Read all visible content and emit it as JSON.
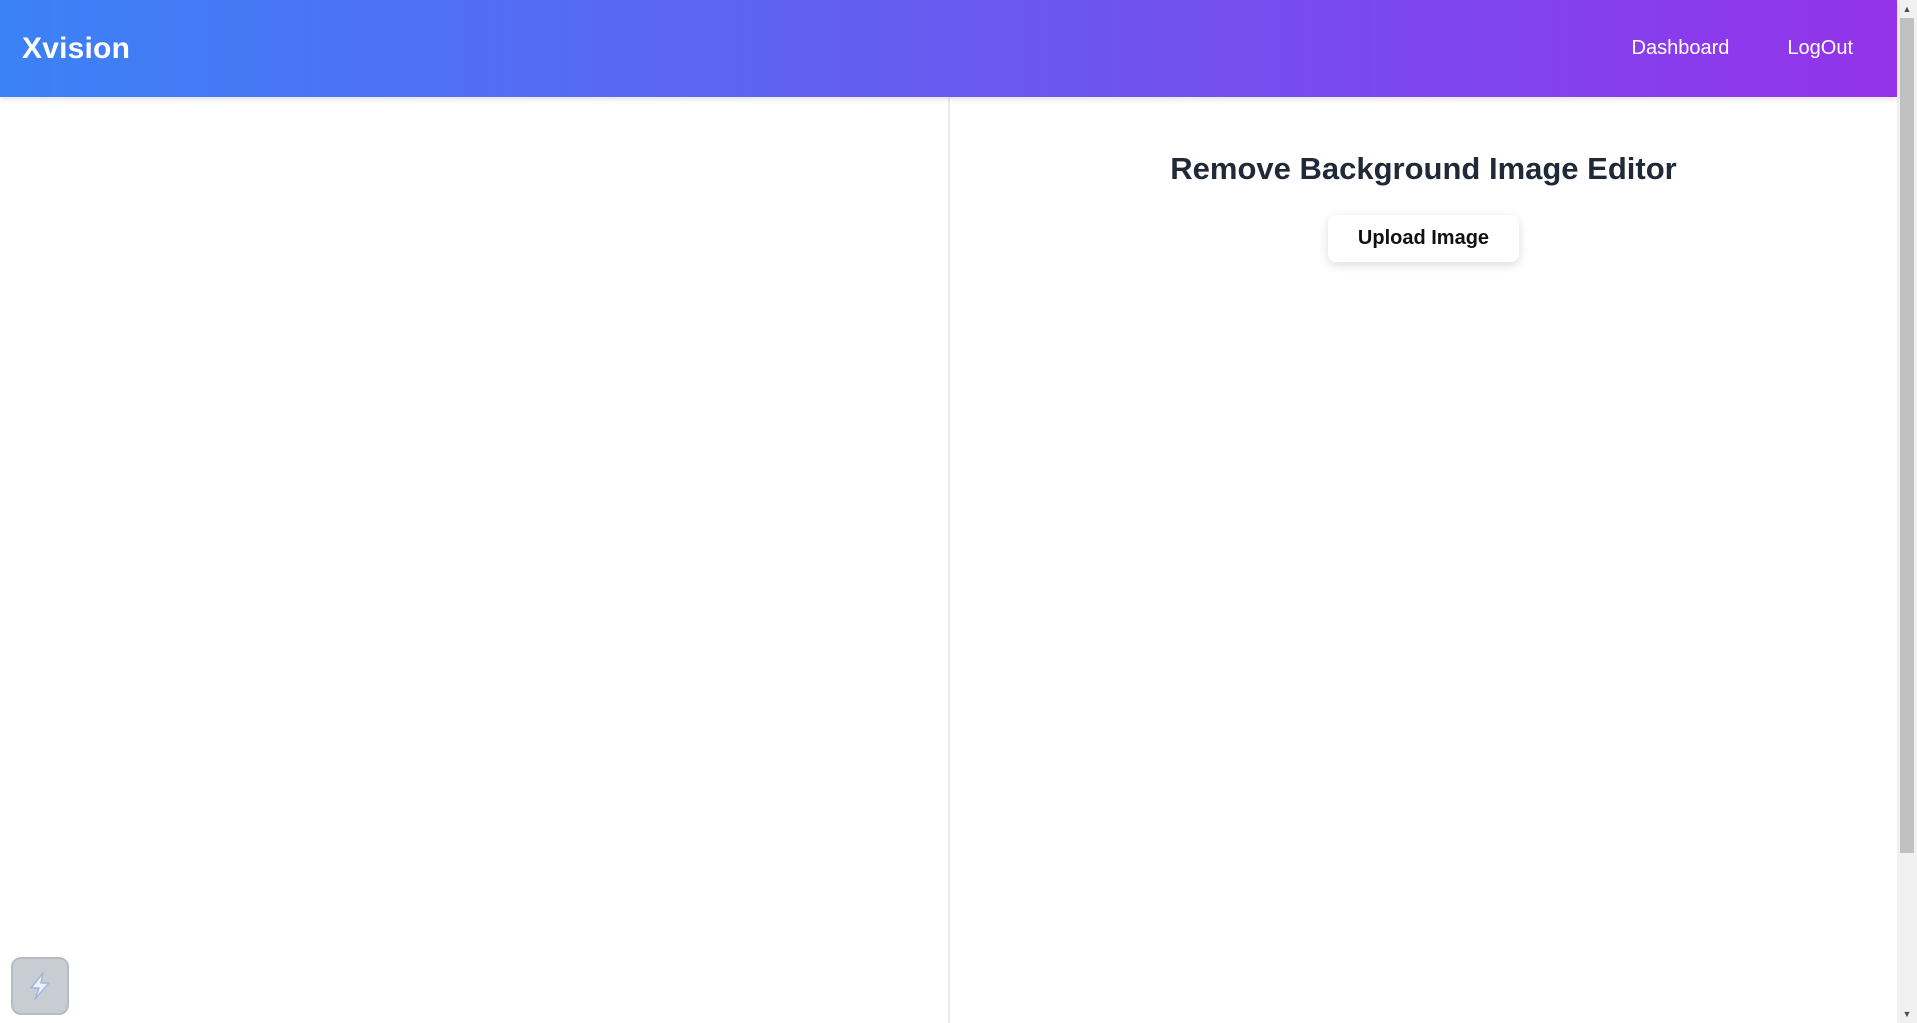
{
  "navbar": {
    "brand": "Xvision",
    "links": [
      {
        "label": "Dashboard"
      },
      {
        "label": "LogOut"
      }
    ],
    "gradient_start": "#3b82f6",
    "gradient_end": "#9333ea"
  },
  "editor": {
    "title": "Remove Background Image Editor",
    "upload_label": "Upload Image"
  },
  "widget": {
    "icon": "lightning-icon"
  },
  "colors": {
    "title_text": "#1f2937",
    "scroll_thumb": "#c1c1c1"
  }
}
